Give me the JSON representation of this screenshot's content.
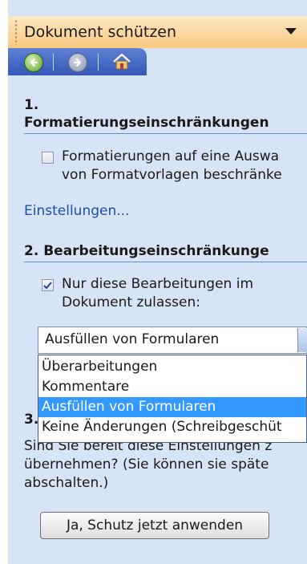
{
  "pane": {
    "title": "Dokument schützen",
    "nav": {
      "back_icon": "back-arrow-icon",
      "forward_icon": "forward-arrow-icon",
      "home_icon": "home-icon"
    }
  },
  "section1": {
    "number": "1.",
    "heading": "Formatierungseinschränkungen",
    "checkbox_label_line1": "Formatierungen auf eine Auswa",
    "checkbox_label_line2": "von Formatvorlagen beschränke",
    "checked": false,
    "link": "Einstellungen..."
  },
  "section2": {
    "heading": "2. Bearbeitungseinschränkunge",
    "checkbox_label_line1": "Nur diese Bearbeitungen im",
    "checkbox_label_line2": "Dokument zulassen:",
    "checked": true,
    "combo_value": "Ausfüllen von Formularen",
    "options": [
      "Überarbeitungen",
      "Kommentare",
      "Ausfüllen von Formularen",
      "Keine Änderungen (Schreibgeschüt"
    ],
    "selected_index": 2
  },
  "section3": {
    "number": "3.",
    "text_line1": "Sind Sie bereit diese Einstellungen z",
    "text_line2": "übernehmen? (Sie können sie späte",
    "text_line3": "abschalten.)",
    "button_label": "Ja, Schutz jetzt anwenden"
  },
  "colors": {
    "pane_bg": "#d7e4f6",
    "header_gradient": "#f8c97f",
    "nav_bar": "#3557b7",
    "link": "#1d4dae",
    "selection": "#3399ff"
  }
}
